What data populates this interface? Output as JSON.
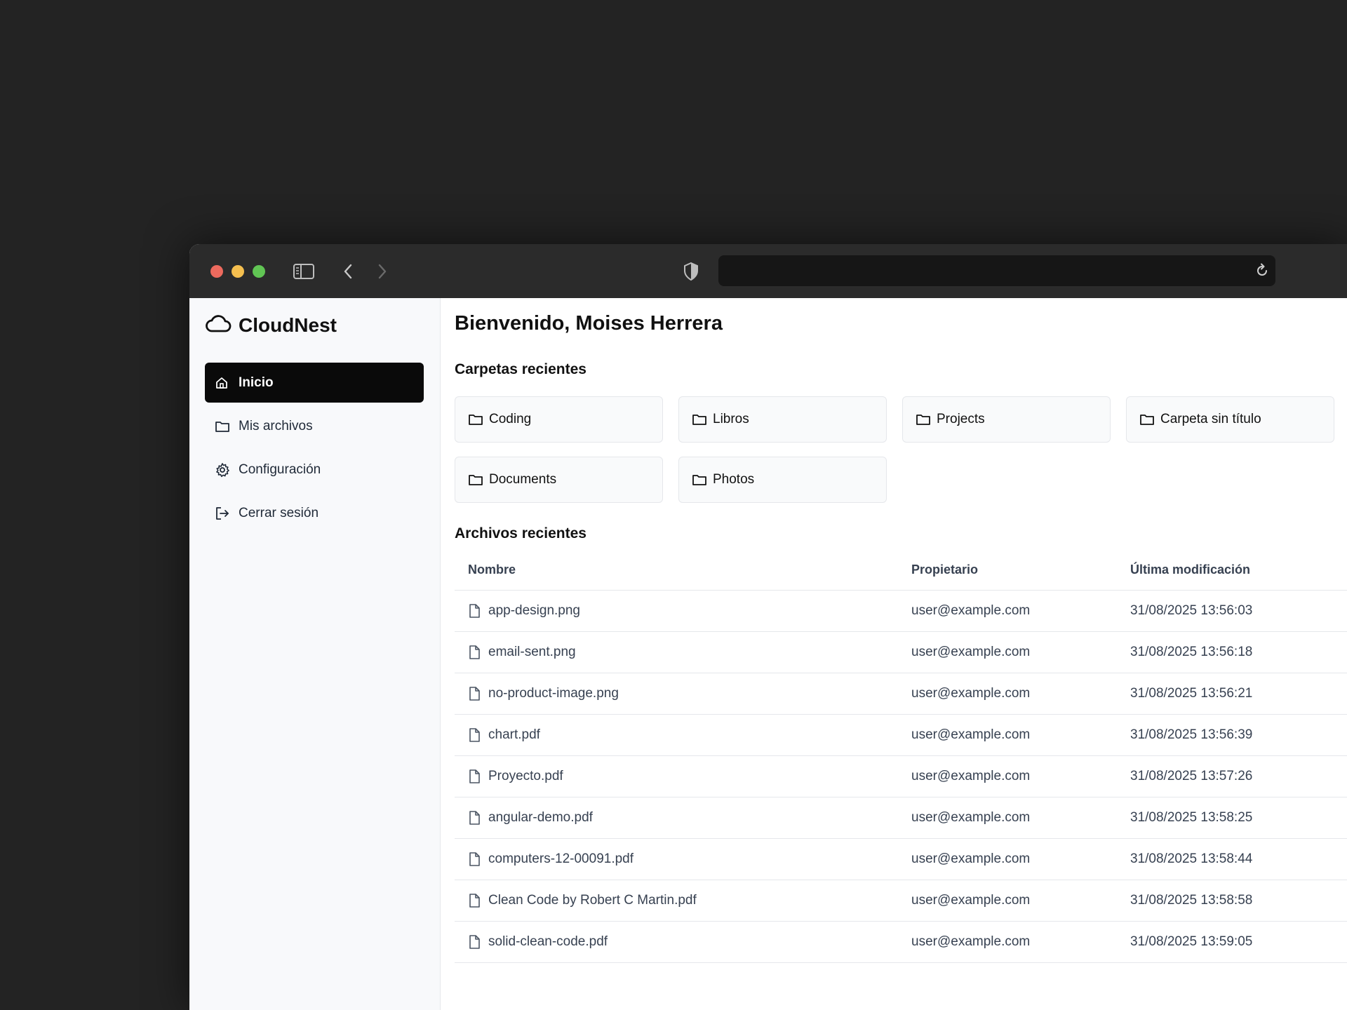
{
  "browser": {
    "url": ""
  },
  "brand": {
    "name": "CloudNest"
  },
  "sidebar": {
    "items": [
      {
        "label": "Inicio",
        "icon": "home-icon",
        "active": true
      },
      {
        "label": "Mis archivos",
        "icon": "folder-icon",
        "active": false
      },
      {
        "label": "Configuración",
        "icon": "gear-icon",
        "active": false
      },
      {
        "label": "Cerrar sesión",
        "icon": "logout-icon",
        "active": false
      }
    ]
  },
  "main": {
    "welcome": "Bienvenido, Moises Herrera",
    "folders_title": "Carpetas recientes",
    "folders": [
      "Coding",
      "Libros",
      "Projects",
      "Carpeta sin título",
      "Documents",
      "Photos"
    ],
    "files_title": "Archivos recientes",
    "columns": [
      "Nombre",
      "Propietario",
      "Última modificación"
    ],
    "files": [
      {
        "name": "app-design.png",
        "owner": "user@example.com",
        "modified": "31/08/2025 13:56:03"
      },
      {
        "name": "email-sent.png",
        "owner": "user@example.com",
        "modified": "31/08/2025 13:56:18"
      },
      {
        "name": "no-product-image.png",
        "owner": "user@example.com",
        "modified": "31/08/2025 13:56:21"
      },
      {
        "name": "chart.pdf",
        "owner": "user@example.com",
        "modified": "31/08/2025 13:56:39"
      },
      {
        "name": "Proyecto.pdf",
        "owner": "user@example.com",
        "modified": "31/08/2025 13:57:26"
      },
      {
        "name": "angular-demo.pdf",
        "owner": "user@example.com",
        "modified": "31/08/2025 13:58:25"
      },
      {
        "name": "computers-12-00091.pdf",
        "owner": "user@example.com",
        "modified": "31/08/2025 13:58:44"
      },
      {
        "name": "Clean Code by Robert C Martin.pdf",
        "owner": "user@example.com",
        "modified": "31/08/2025 13:58:58"
      },
      {
        "name": "solid-clean-code.pdf",
        "owner": "user@example.com",
        "modified": "31/08/2025 13:59:05"
      }
    ]
  },
  "colors": {
    "page_bg": "#232323",
    "titlebar": "#2b2b2b",
    "sidebar_bg": "#f8f9fb",
    "active_nav": "#0a0a0a",
    "border": "#e5e7eb"
  }
}
